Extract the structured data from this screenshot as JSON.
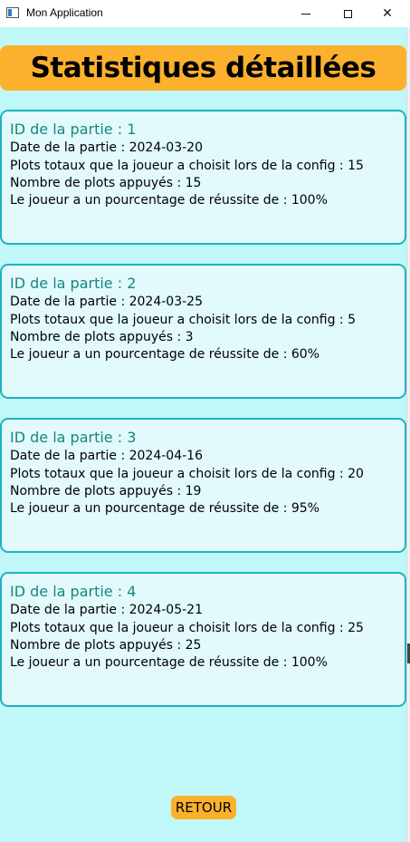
{
  "window": {
    "title": "Mon Application",
    "minimize_glyph": "",
    "close_glyph": "✕"
  },
  "header": {
    "title": "Statistiques détaillées"
  },
  "games": [
    {
      "id_text": "ID de la partie : 1",
      "date_text": "Date de la partie : 2024-03-20",
      "plots_total_text": "Plots totaux que la joueur a choisit lors de la config : 15",
      "plots_pressed_text": "Nombre de plots appuyés : 15",
      "success_text": "Le joueur a un pourcentage de réussite de : 100%"
    },
    {
      "id_text": "ID de la partie : 2",
      "date_text": "Date de la partie : 2024-03-25",
      "plots_total_text": "Plots totaux que la joueur a choisit lors de la config : 5",
      "plots_pressed_text": "Nombre de plots appuyés : 3",
      "success_text": "Le joueur a un pourcentage de réussite de : 60%"
    },
    {
      "id_text": "ID de la partie : 3",
      "date_text": "Date de la partie : 2024-04-16",
      "plots_total_text": "Plots totaux que la joueur a choisit lors de la config : 20",
      "plots_pressed_text": "Nombre de plots appuyés : 19",
      "success_text": "Le joueur a un pourcentage de réussite de : 95%"
    },
    {
      "id_text": "ID de la partie : 4",
      "date_text": "Date de la partie : 2024-05-21",
      "plots_total_text": "Plots totaux que la joueur a choisit lors de la config : 25",
      "plots_pressed_text": "Nombre de plots appuyés : 25",
      "success_text": "Le joueur a un pourcentage de réussite de : 100%"
    }
  ],
  "footer": {
    "back_label": "RETOUR"
  },
  "colors": {
    "background": "#c0f7f9",
    "accent": "#fbb12d",
    "card_border": "#1bb4c0",
    "card_fill": "#e2fafb",
    "id_text": "#17867f"
  }
}
